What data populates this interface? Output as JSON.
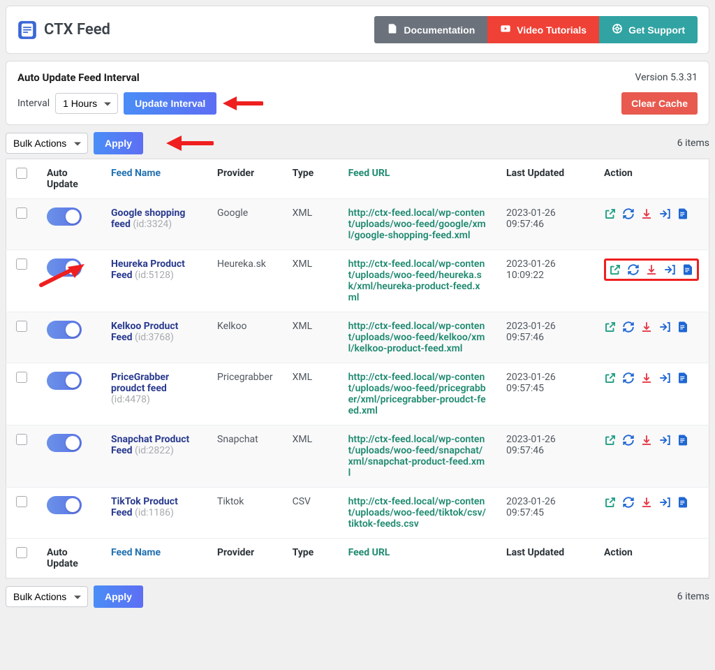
{
  "brand": {
    "title": "CTX Feed"
  },
  "header_buttons": {
    "documentation": "Documentation",
    "video_tutorials": "Video Tutorials",
    "get_support": "Get Support"
  },
  "settings": {
    "title": "Auto Update Feed Interval",
    "version": "Version 5.3.31",
    "interval_label": "Interval",
    "interval_selected": "1 Hours",
    "update_button": "Update Interval",
    "clear_cache": "Clear Cache"
  },
  "bulk": {
    "selected": "Bulk Actions",
    "apply": "Apply",
    "count": "6 items"
  },
  "columns": {
    "auto_update": "Auto Update",
    "feed_name": "Feed Name",
    "provider": "Provider",
    "type": "Type",
    "feed_url": "Feed URL",
    "last_updated": "Last Updated",
    "action": "Action"
  },
  "feeds": [
    {
      "name": "Google shopping feed",
      "id": "(id:3324)",
      "provider": "Google",
      "type": "XML",
      "url": "http://ctx-feed.local/wp-content/uploads/woo-feed/google/xml/google-shopping-feed.xml",
      "updated": "2023-01-26 09:57:46"
    },
    {
      "name": "Heureka Product Feed",
      "id": "(id:5128)",
      "provider": "Heureka.sk",
      "type": "XML",
      "url": "http://ctx-feed.local/wp-content/uploads/woo-feed/heureka.sk/xml/heureka-product-feed.xml",
      "updated": "2023-01-26 10:09:22"
    },
    {
      "name": "Kelkoo Product Feed",
      "id": "(id:3768)",
      "provider": "Kelkoo",
      "type": "XML",
      "url": "http://ctx-feed.local/wp-content/uploads/woo-feed/kelkoo/xml/kelkoo-product-feed.xml",
      "updated": "2023-01-26 09:57:46"
    },
    {
      "name": "PriceGrabber proudct feed",
      "id": "(id:4478)",
      "provider": "Pricegrabber",
      "type": "XML",
      "url": "http://ctx-feed.local/wp-content/uploads/woo-feed/pricegrabber/xml/pricegrabber-proudct-feed.xml",
      "updated": "2023-01-26 09:57:45"
    },
    {
      "name": "Snapchat Product Feed",
      "id": "(id:2822)",
      "provider": "Snapchat",
      "type": "XML",
      "url": "http://ctx-feed.local/wp-content/uploads/woo-feed/snapchat/xml/snapchat-product-feed.xml",
      "updated": "2023-01-26 09:57:46"
    },
    {
      "name": "TikTok Product Feed",
      "id": "(id:1186)",
      "provider": "Tiktok",
      "type": "CSV",
      "url": "http://ctx-feed.local/wp-content/uploads/woo-feed/tiktok/csv/tiktok-feeds.csv",
      "updated": "2023-01-26 09:57:45"
    }
  ]
}
